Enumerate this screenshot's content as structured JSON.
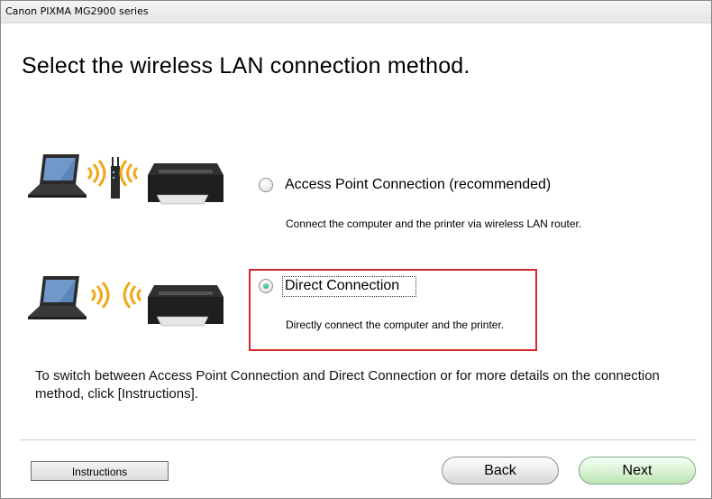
{
  "window": {
    "title": "Canon PIXMA MG2900 series"
  },
  "page": {
    "heading": "Select the wireless LAN connection method."
  },
  "options": [
    {
      "label": "Access Point Connection (recommended)",
      "description": "Connect the computer and the printer via wireless LAN router.",
      "selected": false
    },
    {
      "label": "Direct Connection",
      "description": "Directly connect the computer and the printer.",
      "selected": true
    }
  ],
  "note": "To switch between Access Point Connection and Direct Connection or for more details on the connection method, click [Instructions].",
  "buttons": {
    "instructions": "Instructions",
    "back": "Back",
    "next": "Next"
  },
  "colors": {
    "highlight": "#d42a2a",
    "next_button": "#c6ebbf",
    "radio_selected": "#1f9a6a"
  },
  "icons": [
    "laptop-icon",
    "wifi-waves-icon",
    "router-icon",
    "printer-icon"
  ]
}
